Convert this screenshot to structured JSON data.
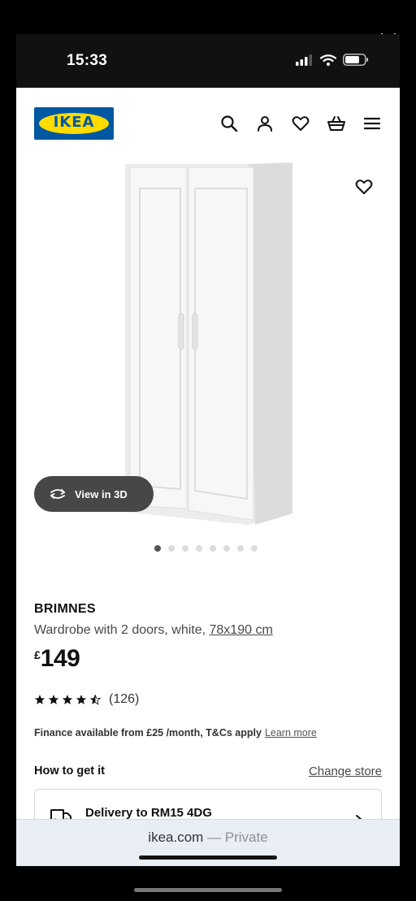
{
  "status_bar": {
    "time": "15:33"
  },
  "header": {
    "logo_text": "IKEA",
    "icons": [
      "search-icon",
      "account-icon",
      "heart-icon",
      "basket-icon",
      "menu-icon"
    ]
  },
  "gallery": {
    "view3d_label": "View in 3D",
    "dot_count": 8,
    "active_dot": 1
  },
  "product": {
    "name": "BRIMNES",
    "description": "Wardrobe with 2 doors, white, ",
    "dimensions": "78x190 cm",
    "price_currency": "£",
    "price_value": "149",
    "rating_stars": 4.5,
    "rating_count": "(126)"
  },
  "finance": {
    "text": "Finance available from £25 /month, T&Cs apply",
    "link": "Learn more"
  },
  "fulfilment": {
    "title": "How to get it",
    "change_store": "Change store",
    "delivery": "Delivery to RM15 4DG"
  },
  "browser": {
    "domain": "ikea.com",
    "separator": " — ",
    "mode": "Private"
  },
  "colors": {
    "ikea_blue": "#0058a3",
    "ikea_yellow": "#ffdb00",
    "pill_bg": "#474747"
  }
}
